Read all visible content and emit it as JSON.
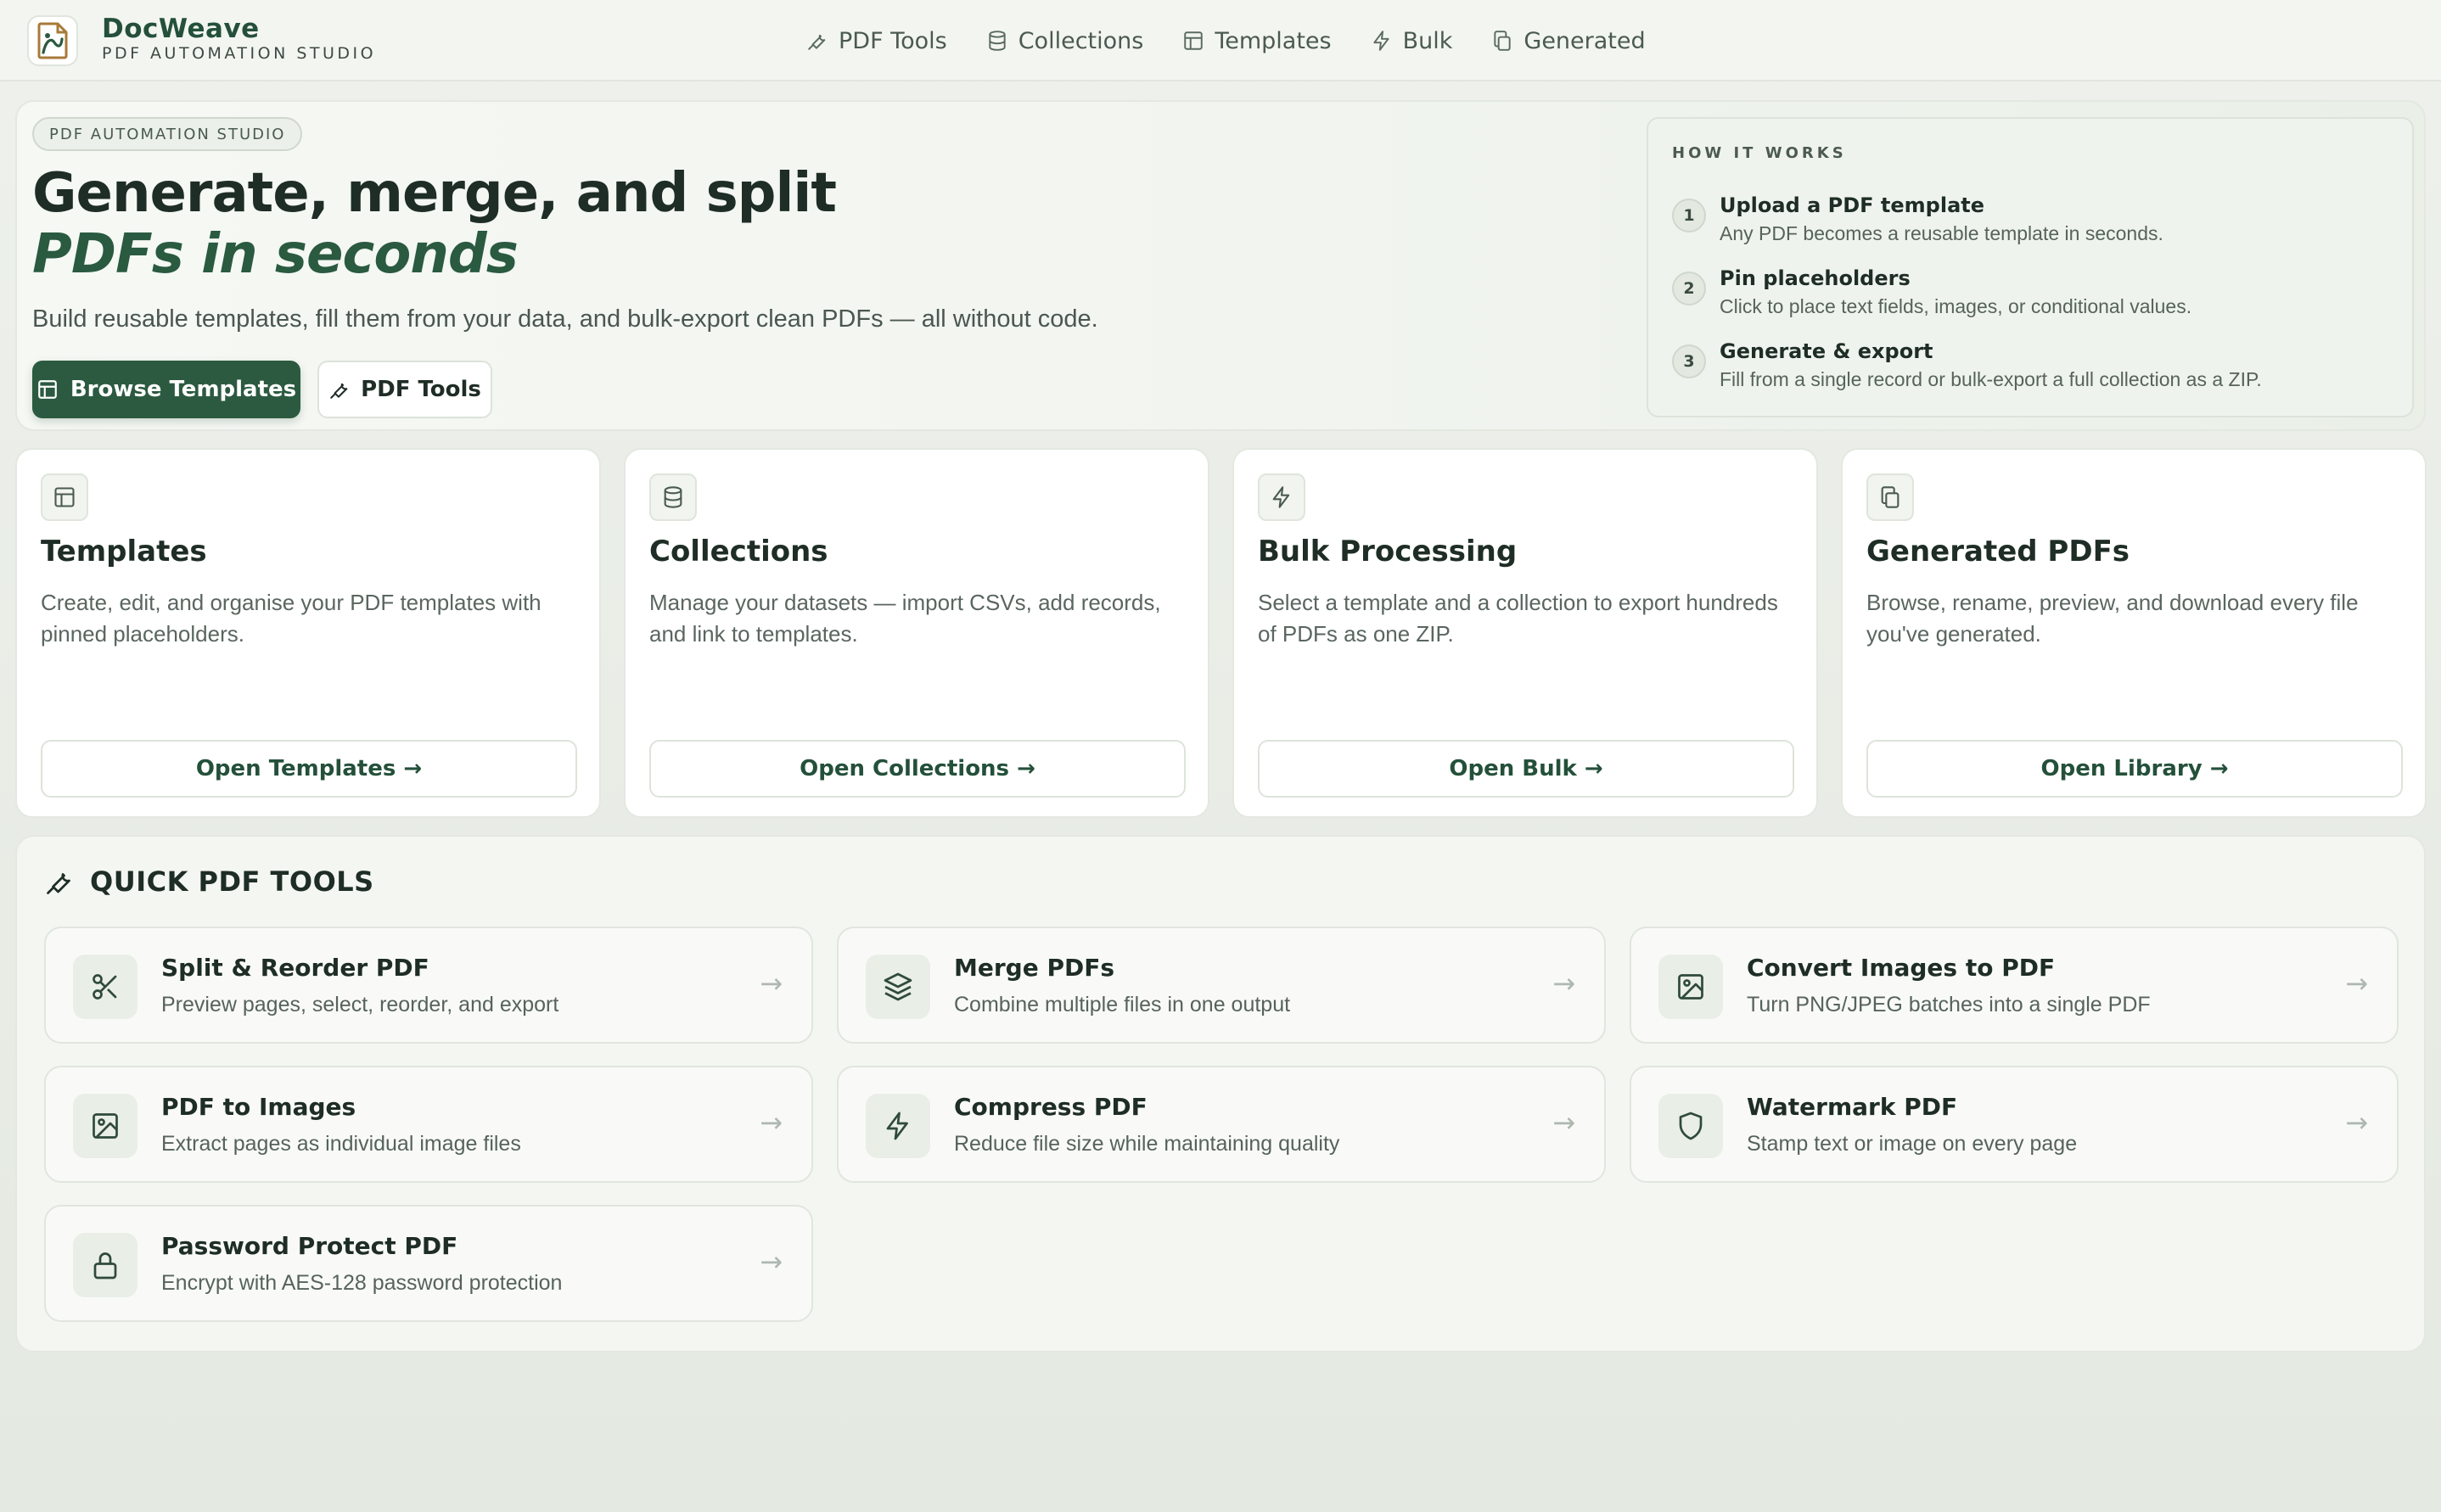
{
  "brand": {
    "name": "DocWeave",
    "tagline": "PDF AUTOMATION STUDIO"
  },
  "nav": {
    "items": [
      {
        "label": "PDF Tools",
        "icon": "wrench-icon"
      },
      {
        "label": "Collections",
        "icon": "database-icon"
      },
      {
        "label": "Templates",
        "icon": "layout-icon"
      },
      {
        "label": "Bulk",
        "icon": "lightning-icon"
      },
      {
        "label": "Generated",
        "icon": "copy-icon"
      }
    ]
  },
  "hero": {
    "pill": "PDF AUTOMATION STUDIO",
    "title_line1": "Generate, merge, and split",
    "title_line2": "PDFs in seconds",
    "description": "Build reusable templates, fill them from your data, and bulk-export clean PDFs — all without code.",
    "primary_button": "Browse Templates",
    "secondary_button": "PDF Tools"
  },
  "how_it_works": {
    "title": "HOW IT WORKS",
    "steps": [
      {
        "num": "1",
        "title": "Upload a PDF template",
        "desc": "Any PDF becomes a reusable template in seconds."
      },
      {
        "num": "2",
        "title": "Pin placeholders",
        "desc": "Click to place text fields, images, or conditional values."
      },
      {
        "num": "3",
        "title": "Generate & export",
        "desc": "Fill from a single record or bulk-export a full collection as a ZIP."
      }
    ]
  },
  "cards": [
    {
      "title": "Templates",
      "desc": "Create, edit, and organise your PDF templates with pinned placeholders.",
      "button": "Open Templates →",
      "icon": "layout-icon"
    },
    {
      "title": "Collections",
      "desc": "Manage your datasets — import CSVs, add records, and link to templates.",
      "button": "Open Collections →",
      "icon": "database-icon"
    },
    {
      "title": "Bulk Processing",
      "desc": "Select a template and a collection to export hundreds of PDFs as one ZIP.",
      "button": "Open Bulk →",
      "icon": "lightning-icon"
    },
    {
      "title": "Generated PDFs",
      "desc": "Browse, rename, preview, and download every file you've generated.",
      "button": "Open Library →",
      "icon": "copy-icon"
    }
  ],
  "quick_tools": {
    "title": "QUICK PDF TOOLS",
    "items": [
      {
        "title": "Split & Reorder PDF",
        "desc": "Preview pages, select, reorder, and export",
        "icon": "scissors-icon",
        "arrow": "→"
      },
      {
        "title": "Merge PDFs",
        "desc": "Combine multiple files in one output",
        "icon": "layers-icon",
        "arrow": "→"
      },
      {
        "title": "Convert Images to PDF",
        "desc": "Turn PNG/JPEG batches into a single PDF",
        "icon": "image-icon",
        "arrow": "→"
      },
      {
        "title": "PDF to Images",
        "desc": "Extract pages as individual image files",
        "icon": "image-icon",
        "arrow": "→"
      },
      {
        "title": "Compress PDF",
        "desc": "Reduce file size while maintaining quality",
        "icon": "lightning-icon",
        "arrow": "→"
      },
      {
        "title": "Watermark PDF",
        "desc": "Stamp text or image on every page",
        "icon": "shield-icon",
        "arrow": "→"
      },
      {
        "title": "Password Protect PDF",
        "desc": "Encrypt with AES-128 password protection",
        "icon": "lock-icon",
        "arrow": "→"
      }
    ]
  },
  "colors": {
    "accent": "#2b5a40",
    "background": "#eef1ec",
    "card": "#ffffff"
  }
}
